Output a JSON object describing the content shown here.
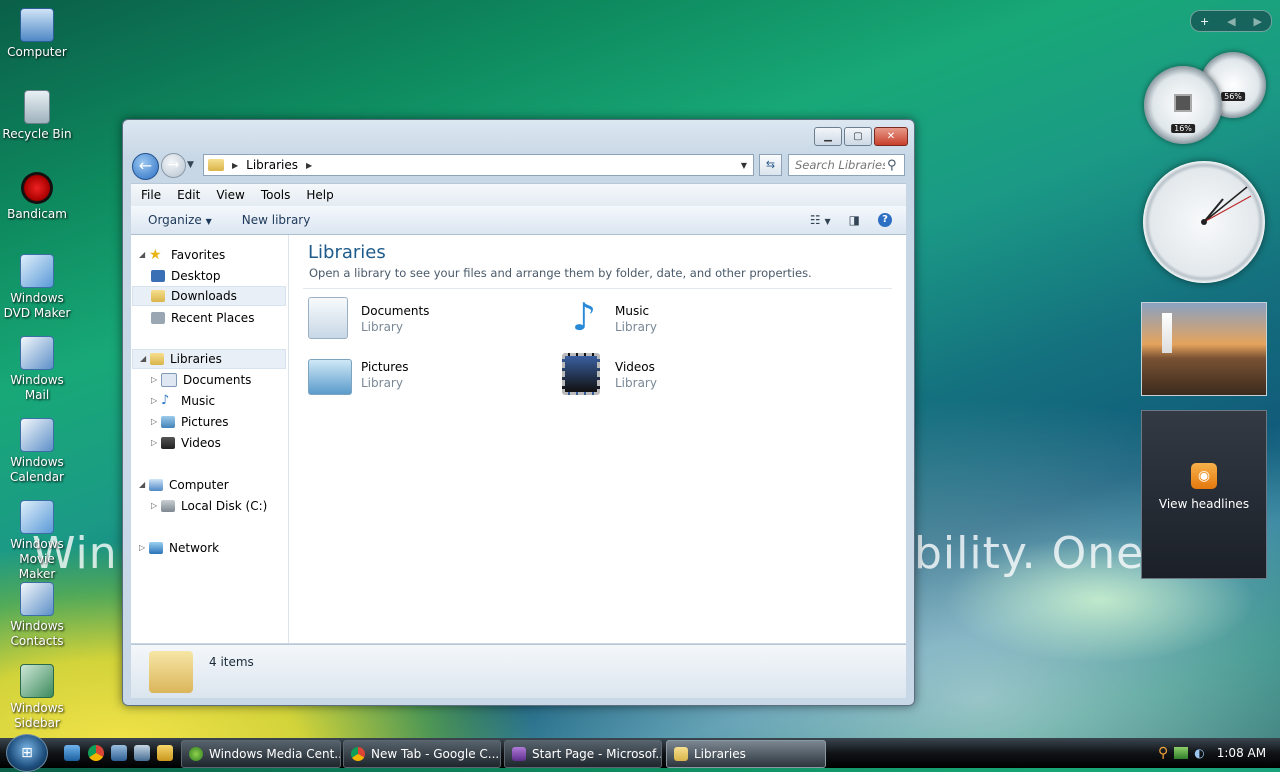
{
  "wallpaper": {
    "text_left": "Win",
    "text_right": "bility. One C"
  },
  "desktop_icons": [
    {
      "label": "Computer"
    },
    {
      "label": "Recycle Bin"
    },
    {
      "label": "Bandicam"
    },
    {
      "label": "Windows DVD Maker"
    },
    {
      "label": "Windows Mail"
    },
    {
      "label": "Windows Calendar"
    },
    {
      "label": "Windows Movie Maker"
    },
    {
      "label": "Windows Contacts"
    },
    {
      "label": "Windows Sidebar"
    }
  ],
  "window": {
    "address": {
      "path": "Libraries"
    },
    "search": {
      "placeholder": "Search Libraries"
    },
    "menu": [
      "File",
      "Edit",
      "View",
      "Tools",
      "Help"
    ],
    "commands": {
      "organize": "Organize",
      "new_library": "New library"
    },
    "nav": {
      "favorites": "Favorites",
      "desktop": "Desktop",
      "downloads": "Downloads",
      "recent": "Recent Places",
      "libraries": "Libraries",
      "documents": "Documents",
      "music": "Music",
      "pictures": "Pictures",
      "videos": "Videos",
      "computer": "Computer",
      "local_disk": "Local Disk (C:)",
      "network": "Network"
    },
    "content": {
      "title": "Libraries",
      "subtitle": "Open a library to see your files and arrange them by folder, date, and other properties.",
      "items": [
        {
          "name": "Documents",
          "type": "Library"
        },
        {
          "name": "Music",
          "type": "Library"
        },
        {
          "name": "Pictures",
          "type": "Library"
        },
        {
          "name": "Videos",
          "type": "Library"
        }
      ]
    },
    "status": {
      "count": "4 items"
    }
  },
  "gadgets": {
    "cpu_meter": {
      "cpu": "16%",
      "memory": "56%"
    },
    "feed": {
      "label": "View headlines"
    }
  },
  "taskbar": {
    "buttons": [
      {
        "label": "Windows Media Cent..."
      },
      {
        "label": "New Tab - Google C..."
      },
      {
        "label": "Start Page - Microsof..."
      },
      {
        "label": "Libraries"
      }
    ],
    "clock": "1:08 AM"
  }
}
